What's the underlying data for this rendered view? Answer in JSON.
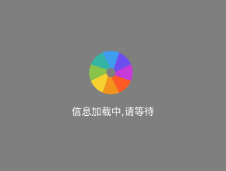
{
  "loading": {
    "message": "信息加载中,请等待",
    "icon": "aperture-spinner-icon",
    "spinner_colors": [
      "#3f9dee",
      "#6f4ef0",
      "#c83ad7",
      "#ff5a23",
      "#f2941b",
      "#f6d231",
      "#8ac349",
      "#35b3a4"
    ]
  }
}
